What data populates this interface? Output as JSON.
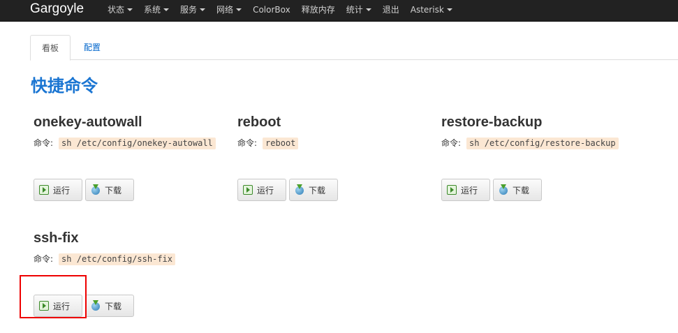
{
  "navbar": {
    "brand": "Gargoyle",
    "items": [
      {
        "label": "状态",
        "dropdown": true
      },
      {
        "label": "系统",
        "dropdown": true
      },
      {
        "label": "服务",
        "dropdown": true
      },
      {
        "label": "网络",
        "dropdown": true
      },
      {
        "label": "ColorBox",
        "dropdown": false
      },
      {
        "label": "释放内存",
        "dropdown": false
      },
      {
        "label": "统计",
        "dropdown": true
      },
      {
        "label": "退出",
        "dropdown": false
      },
      {
        "label": "Asterisk",
        "dropdown": true
      }
    ]
  },
  "tabs": {
    "active": "看板",
    "other": "配置"
  },
  "section_title": "快捷命令",
  "command_label": "命令:",
  "buttons": {
    "run": "运行",
    "download": "下载"
  },
  "commands": [
    {
      "name": "onekey-autowall",
      "command": "sh /etc/config/onekey-autowall"
    },
    {
      "name": "reboot",
      "command": "reboot"
    },
    {
      "name": "restore-backup",
      "command": "sh /etc/config/restore-backup"
    },
    {
      "name": "ssh-fix",
      "command": "sh /etc/config/ssh-fix"
    }
  ],
  "colors": {
    "navbar_bg": "#222222",
    "section_title": "#1a75d2",
    "code_bg": "#fbe7d3",
    "highlight": "#ee0000"
  },
  "icons": {
    "run": "play-icon",
    "download": "download-globe-icon"
  }
}
